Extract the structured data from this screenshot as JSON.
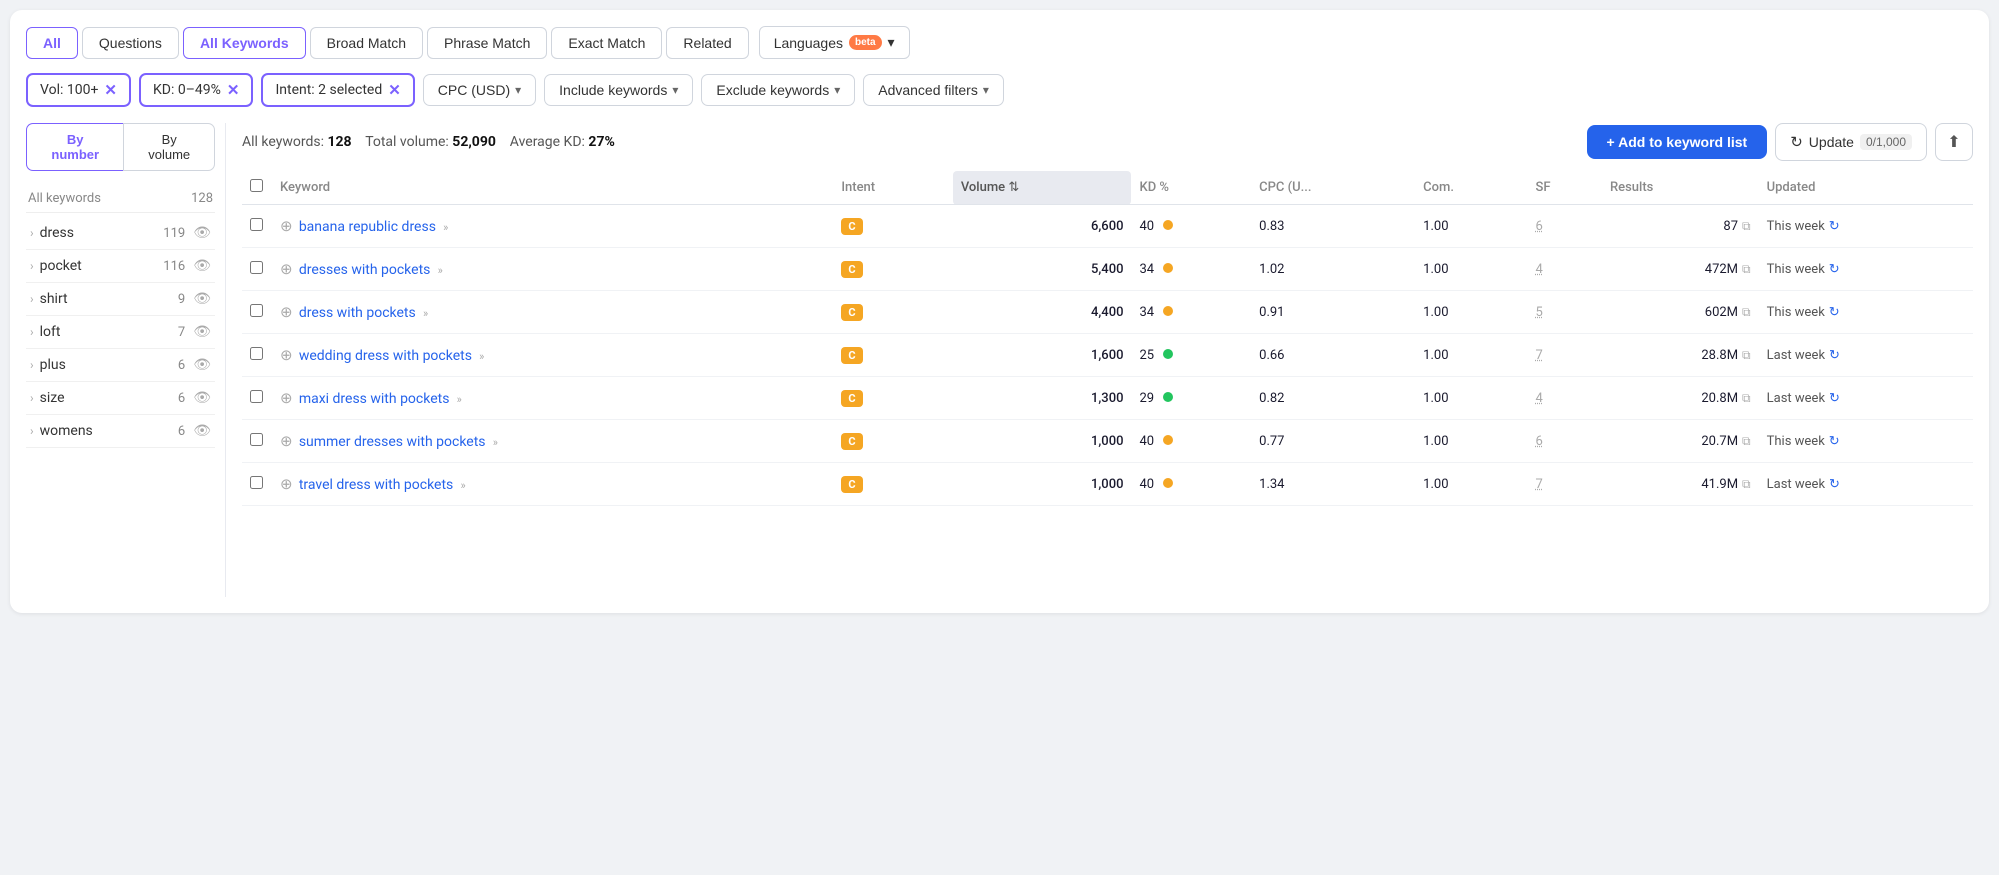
{
  "tabs": [
    {
      "label": "All",
      "active": true
    },
    {
      "label": "Questions",
      "active": false
    },
    {
      "label": "All Keywords",
      "active": true
    },
    {
      "label": "Broad Match",
      "active": false
    },
    {
      "label": "Phrase Match",
      "active": false
    },
    {
      "label": "Exact Match",
      "active": false
    },
    {
      "label": "Related",
      "active": false
    }
  ],
  "languages_btn": "Languages",
  "beta_label": "beta",
  "active_filters": [
    {
      "label": "Vol: 100+",
      "id": "vol"
    },
    {
      "label": "KD: 0–49%",
      "id": "kd"
    },
    {
      "label": "Intent: 2 selected",
      "id": "intent"
    }
  ],
  "filter_dropdowns": [
    {
      "label": "CPC (USD)"
    },
    {
      "label": "Include keywords"
    },
    {
      "label": "Exclude keywords"
    },
    {
      "label": "Advanced filters"
    }
  ],
  "sort_btns": [
    {
      "label": "By number",
      "active": true
    },
    {
      "label": "By volume",
      "active": false
    }
  ],
  "sidebar": {
    "header_label": "All keywords",
    "header_count": "128",
    "items": [
      {
        "label": "dress",
        "count": "119"
      },
      {
        "label": "pocket",
        "count": "116"
      },
      {
        "label": "shirt",
        "count": "9"
      },
      {
        "label": "loft",
        "count": "7"
      },
      {
        "label": "plus",
        "count": "6"
      },
      {
        "label": "size",
        "count": "6"
      },
      {
        "label": "womens",
        "count": "6"
      }
    ]
  },
  "stats": {
    "all_keywords_label": "All keywords:",
    "all_keywords_value": "128",
    "total_volume_label": "Total volume:",
    "total_volume_value": "52,090",
    "avg_kd_label": "Average KD:",
    "avg_kd_value": "27%"
  },
  "buttons": {
    "add_label": "+ Add to keyword list",
    "update_label": "Update",
    "update_count": "0/1,000"
  },
  "table": {
    "columns": [
      "",
      "Keyword",
      "Intent",
      "Volume",
      "KD %",
      "CPC (U...",
      "Com.",
      "SF",
      "Results",
      "Updated"
    ],
    "rows": [
      {
        "keyword": "banana republic dress",
        "intent": "C",
        "volume": "6,600",
        "kd": "40",
        "kd_dot": "yellow",
        "cpc": "0.83",
        "com": "1.00",
        "sf": "6",
        "results": "87",
        "updated": "This week"
      },
      {
        "keyword": "dresses with pockets",
        "intent": "C",
        "volume": "5,400",
        "kd": "34",
        "kd_dot": "yellow",
        "cpc": "1.02",
        "com": "1.00",
        "sf": "4",
        "results": "472M",
        "updated": "This week"
      },
      {
        "keyword": "dress with pockets",
        "intent": "C",
        "volume": "4,400",
        "kd": "34",
        "kd_dot": "yellow",
        "cpc": "0.91",
        "com": "1.00",
        "sf": "5",
        "results": "602M",
        "updated": "This week"
      },
      {
        "keyword": "wedding dress with pockets",
        "intent": "C",
        "volume": "1,600",
        "kd": "25",
        "kd_dot": "green",
        "cpc": "0.66",
        "com": "1.00",
        "sf": "7",
        "results": "28.8M",
        "updated": "Last week"
      },
      {
        "keyword": "maxi dress with pockets",
        "intent": "C",
        "volume": "1,300",
        "kd": "29",
        "kd_dot": "green",
        "cpc": "0.82",
        "com": "1.00",
        "sf": "4",
        "results": "20.8M",
        "updated": "Last week"
      },
      {
        "keyword": "summer dresses with pockets",
        "intent": "C",
        "volume": "1,000",
        "kd": "40",
        "kd_dot": "yellow",
        "cpc": "0.77",
        "com": "1.00",
        "sf": "6",
        "results": "20.7M",
        "updated": "This week"
      },
      {
        "keyword": "travel dress with pockets",
        "intent": "C",
        "volume": "1,000",
        "kd": "40",
        "kd_dot": "yellow",
        "cpc": "1.34",
        "com": "1.00",
        "sf": "7",
        "results": "41.9M",
        "updated": "Last week"
      }
    ]
  }
}
